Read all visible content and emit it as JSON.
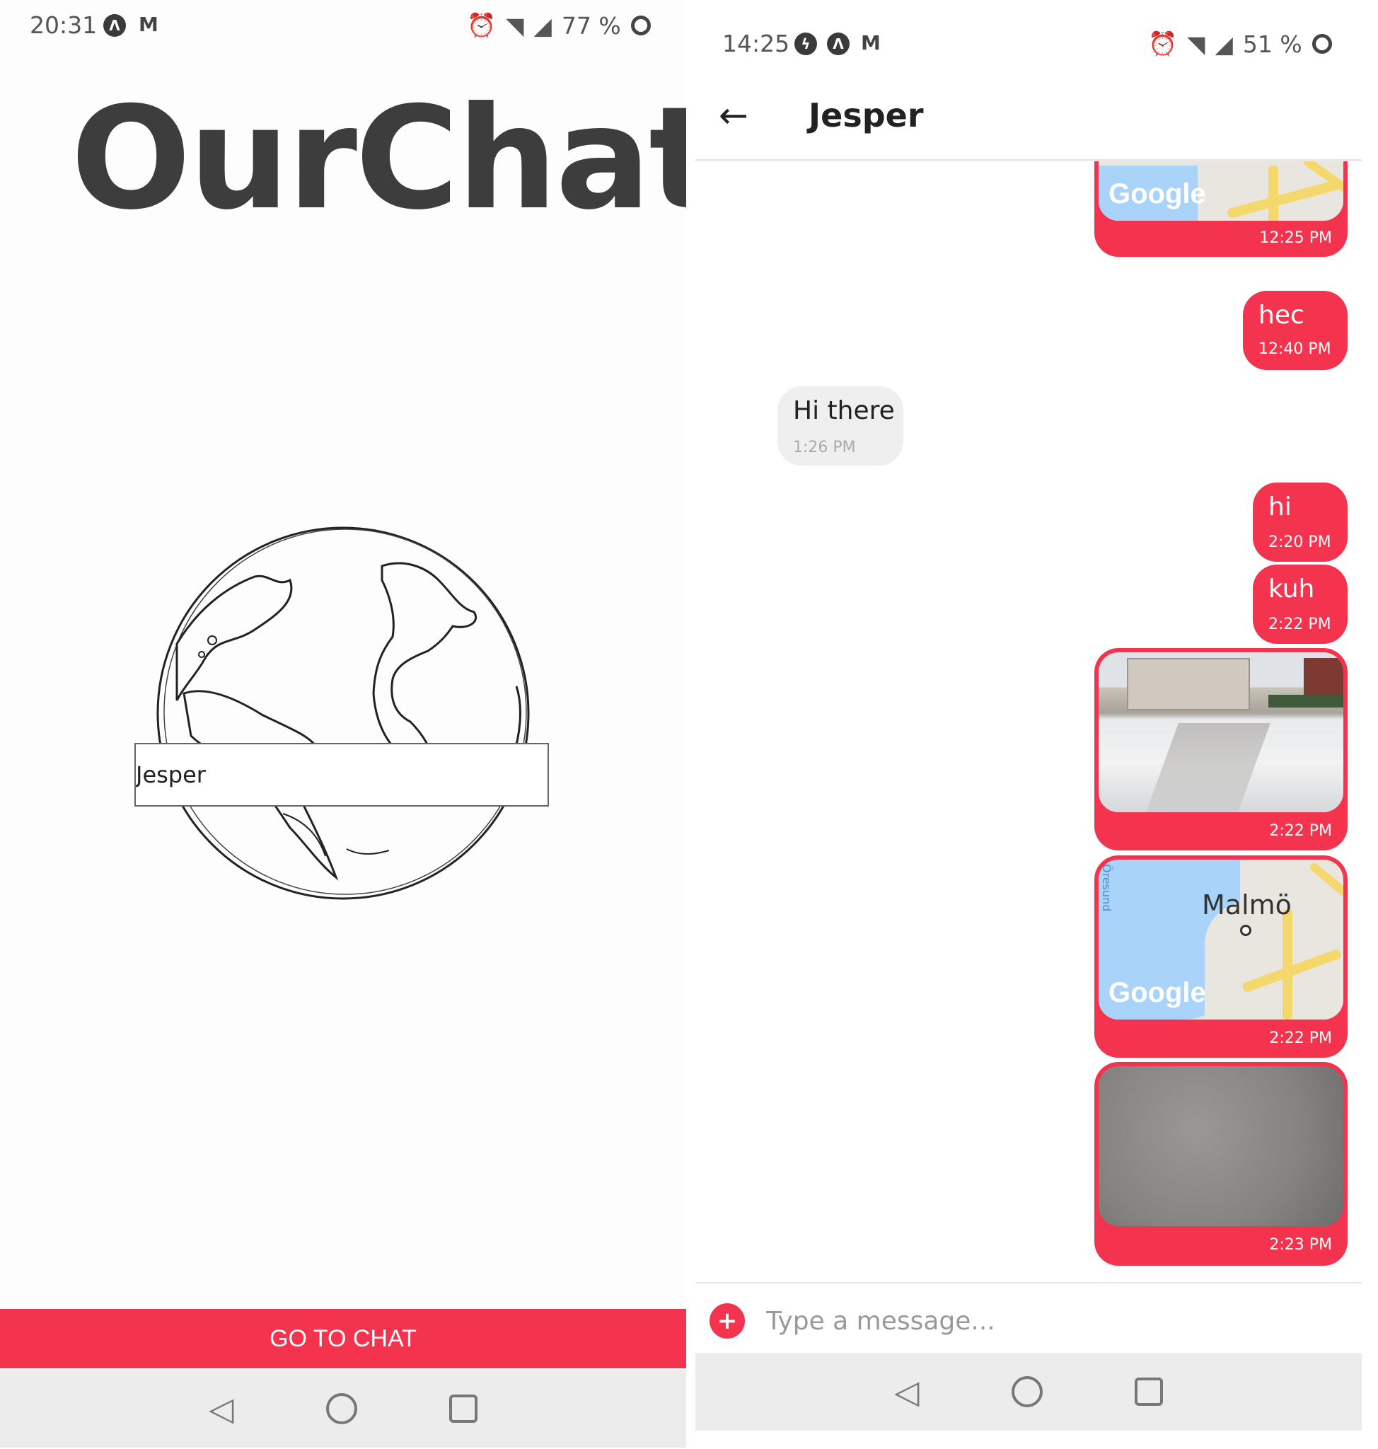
{
  "left": {
    "status": {
      "time": "20:31",
      "battery": "77 %"
    },
    "app_title": "OurChat",
    "name_field": {
      "value": "Jesper"
    },
    "go_button_label": "GO TO CHAT"
  },
  "right": {
    "status": {
      "time": "14:25",
      "battery": "51 %"
    },
    "chat_title": "Jesper",
    "messages": [
      {
        "from": "me",
        "type": "map",
        "time": "12:25 PM",
        "map_logo": "Google"
      },
      {
        "from": "me",
        "type": "text",
        "text": "hec",
        "time": "12:40 PM"
      },
      {
        "from": "them",
        "type": "text",
        "text": "Hi there",
        "time": "1:26 PM"
      },
      {
        "from": "me",
        "type": "text",
        "text": "hi",
        "time": "2:20 PM"
      },
      {
        "from": "me",
        "type": "text",
        "text": "kuh",
        "time": "2:22 PM"
      },
      {
        "from": "me",
        "type": "image",
        "time": "2:22 PM"
      },
      {
        "from": "me",
        "type": "map",
        "time": "2:22 PM",
        "map_city": "Malmö",
        "map_water_label": "Öresund",
        "map_logo": "Google"
      },
      {
        "from": "me",
        "type": "image",
        "time": "2:23 PM"
      }
    ],
    "composer_placeholder": "Type a message..."
  },
  "colors": {
    "accent": "#f4344f",
    "incoming_bubble": "#efefef",
    "navbar": "#ececec"
  },
  "icons": [
    "alarm-icon",
    "wifi-icon",
    "signal-icon",
    "battery-icon",
    "messenger-icon",
    "app-a-icon",
    "gmail-icon",
    "back-arrow-icon",
    "plus-icon",
    "nav-back-icon",
    "nav-home-icon",
    "nav-recents-icon"
  ]
}
